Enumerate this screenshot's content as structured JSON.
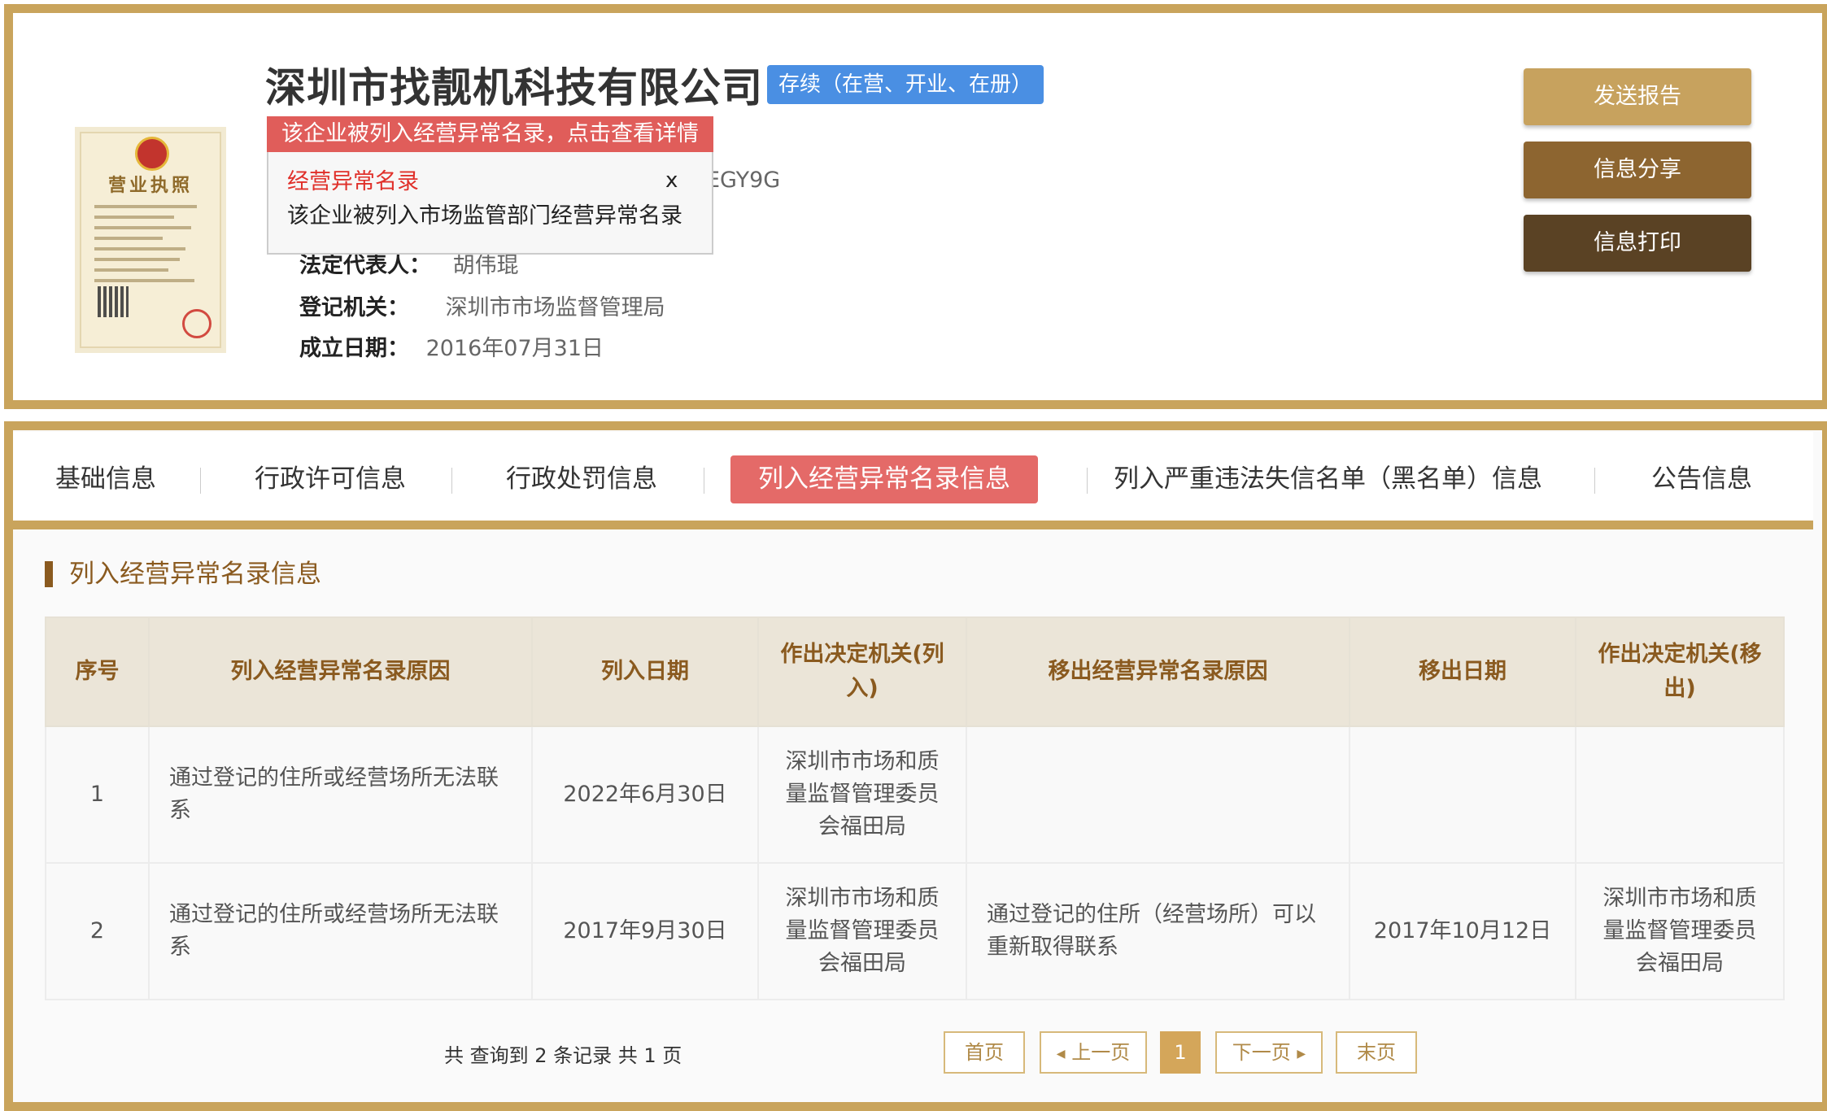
{
  "company": {
    "name": "深圳市找靓机科技有限公司",
    "status": "存续（在营、开业、在册）",
    "code_fragment": "EGY9G",
    "info": [
      {
        "label": "法定代表人：",
        "value": "胡伟琨"
      },
      {
        "label": "登记机关：",
        "value": "深圳市市场监督管理局"
      },
      {
        "label": "成立日期：",
        "value": "2016年07月31日"
      }
    ]
  },
  "license_image": {
    "title": "营业执照"
  },
  "popup": {
    "header": "该企业被列入经营异常名录，点击查看详情",
    "title": "经营异常名录",
    "close": "x",
    "text": "该企业被列入市场监管部门经营异常名录"
  },
  "actions": {
    "send_report": "发送报告",
    "share": "信息分享",
    "print": "信息打印"
  },
  "colors": {
    "border_gold": "#c9a45c",
    "send_report_bg": "#c7a25e",
    "share_bg": "#8d6530",
    "print_bg": "#5a4224",
    "active_tab_bg": "#e46a68",
    "status_badge_bg": "#4a8fe3",
    "popup_header_bg": "#e05d5a"
  },
  "tabs": [
    {
      "label": "基础信息",
      "active": false
    },
    {
      "label": "行政许可信息",
      "active": false
    },
    {
      "label": "行政处罚信息",
      "active": false
    },
    {
      "label": "列入经营异常名录信息",
      "active": true
    },
    {
      "label": "列入严重违法失信名单（黑名单）信息",
      "active": false
    },
    {
      "label": "公告信息",
      "active": false
    }
  ],
  "section": {
    "title": "列入经营异常名录信息"
  },
  "table": {
    "headers": [
      "序号",
      "列入经营异常名录原因",
      "列入日期",
      "作出决定机关(列入)",
      "移出经营异常名录原因",
      "移出日期",
      "作出决定机关(移出)"
    ],
    "rows": [
      [
        "1",
        "通过登记的住所或经营场所无法联系",
        "2022年6月30日",
        "深圳市市场和质量监督管理委员会福田局",
        "",
        "",
        ""
      ],
      [
        "2",
        "通过登记的住所或经营场所无法联系",
        "2017年9月30日",
        "深圳市市场和质量监督管理委员会福田局",
        "通过登记的住所（经营场所）可以重新取得联系",
        "2017年10月12日",
        "深圳市市场和质量监督管理委员会福田局"
      ]
    ]
  },
  "pager": {
    "summary": "共 查询到 2 条记录 共 1 页",
    "first": "首页",
    "prev": "上一页",
    "current": "1",
    "next": "下一页",
    "last": "末页"
  }
}
